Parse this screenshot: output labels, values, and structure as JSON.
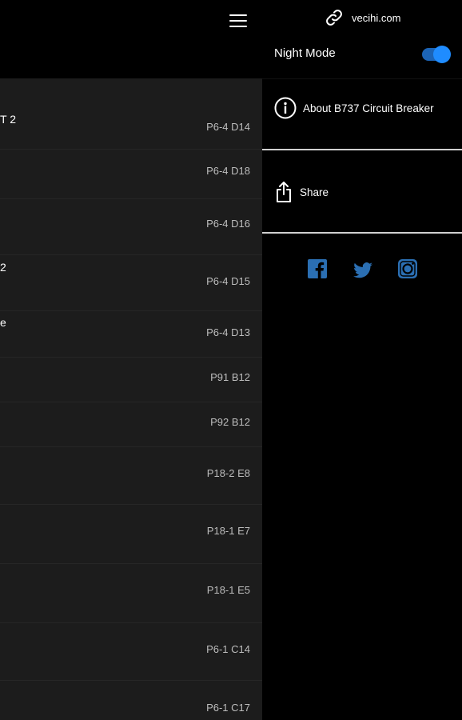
{
  "main": {
    "rows": [
      {
        "title": "T 2",
        "ref": "P6-4 D14"
      },
      {
        "title": "",
        "ref": "P6-4 D18"
      },
      {
        "title": "",
        "ref": "P6-4 D16"
      },
      {
        "title": "2",
        "ref": "P6-4 D15"
      },
      {
        "title": "e",
        "ref": "P6-4 D13"
      },
      {
        "title": "",
        "ref": "P91 B12"
      },
      {
        "title": "",
        "ref": "P92 B12"
      },
      {
        "title": "",
        "ref": "P18-2 E8"
      },
      {
        "title": "",
        "ref": "P18-1 E7"
      },
      {
        "title": "",
        "ref": "P18-1 E5"
      },
      {
        "title": "",
        "ref": "P6-1 C14"
      },
      {
        "title": "",
        "ref": "P6-1 C17"
      }
    ]
  },
  "drawer": {
    "website": "vecihi.com",
    "night_mode_label": "Night Mode",
    "night_mode_on": true,
    "about_label": "About B737 Circuit Breaker",
    "share_label": "Share",
    "social": [
      "facebook-icon",
      "twitter-icon",
      "instagram-icon"
    ]
  },
  "colors": {
    "accent": "#1f8cff",
    "social_blue": "#2b6fb3",
    "list_bg": "#1c1c1c",
    "drawer_bg": "#000000"
  }
}
